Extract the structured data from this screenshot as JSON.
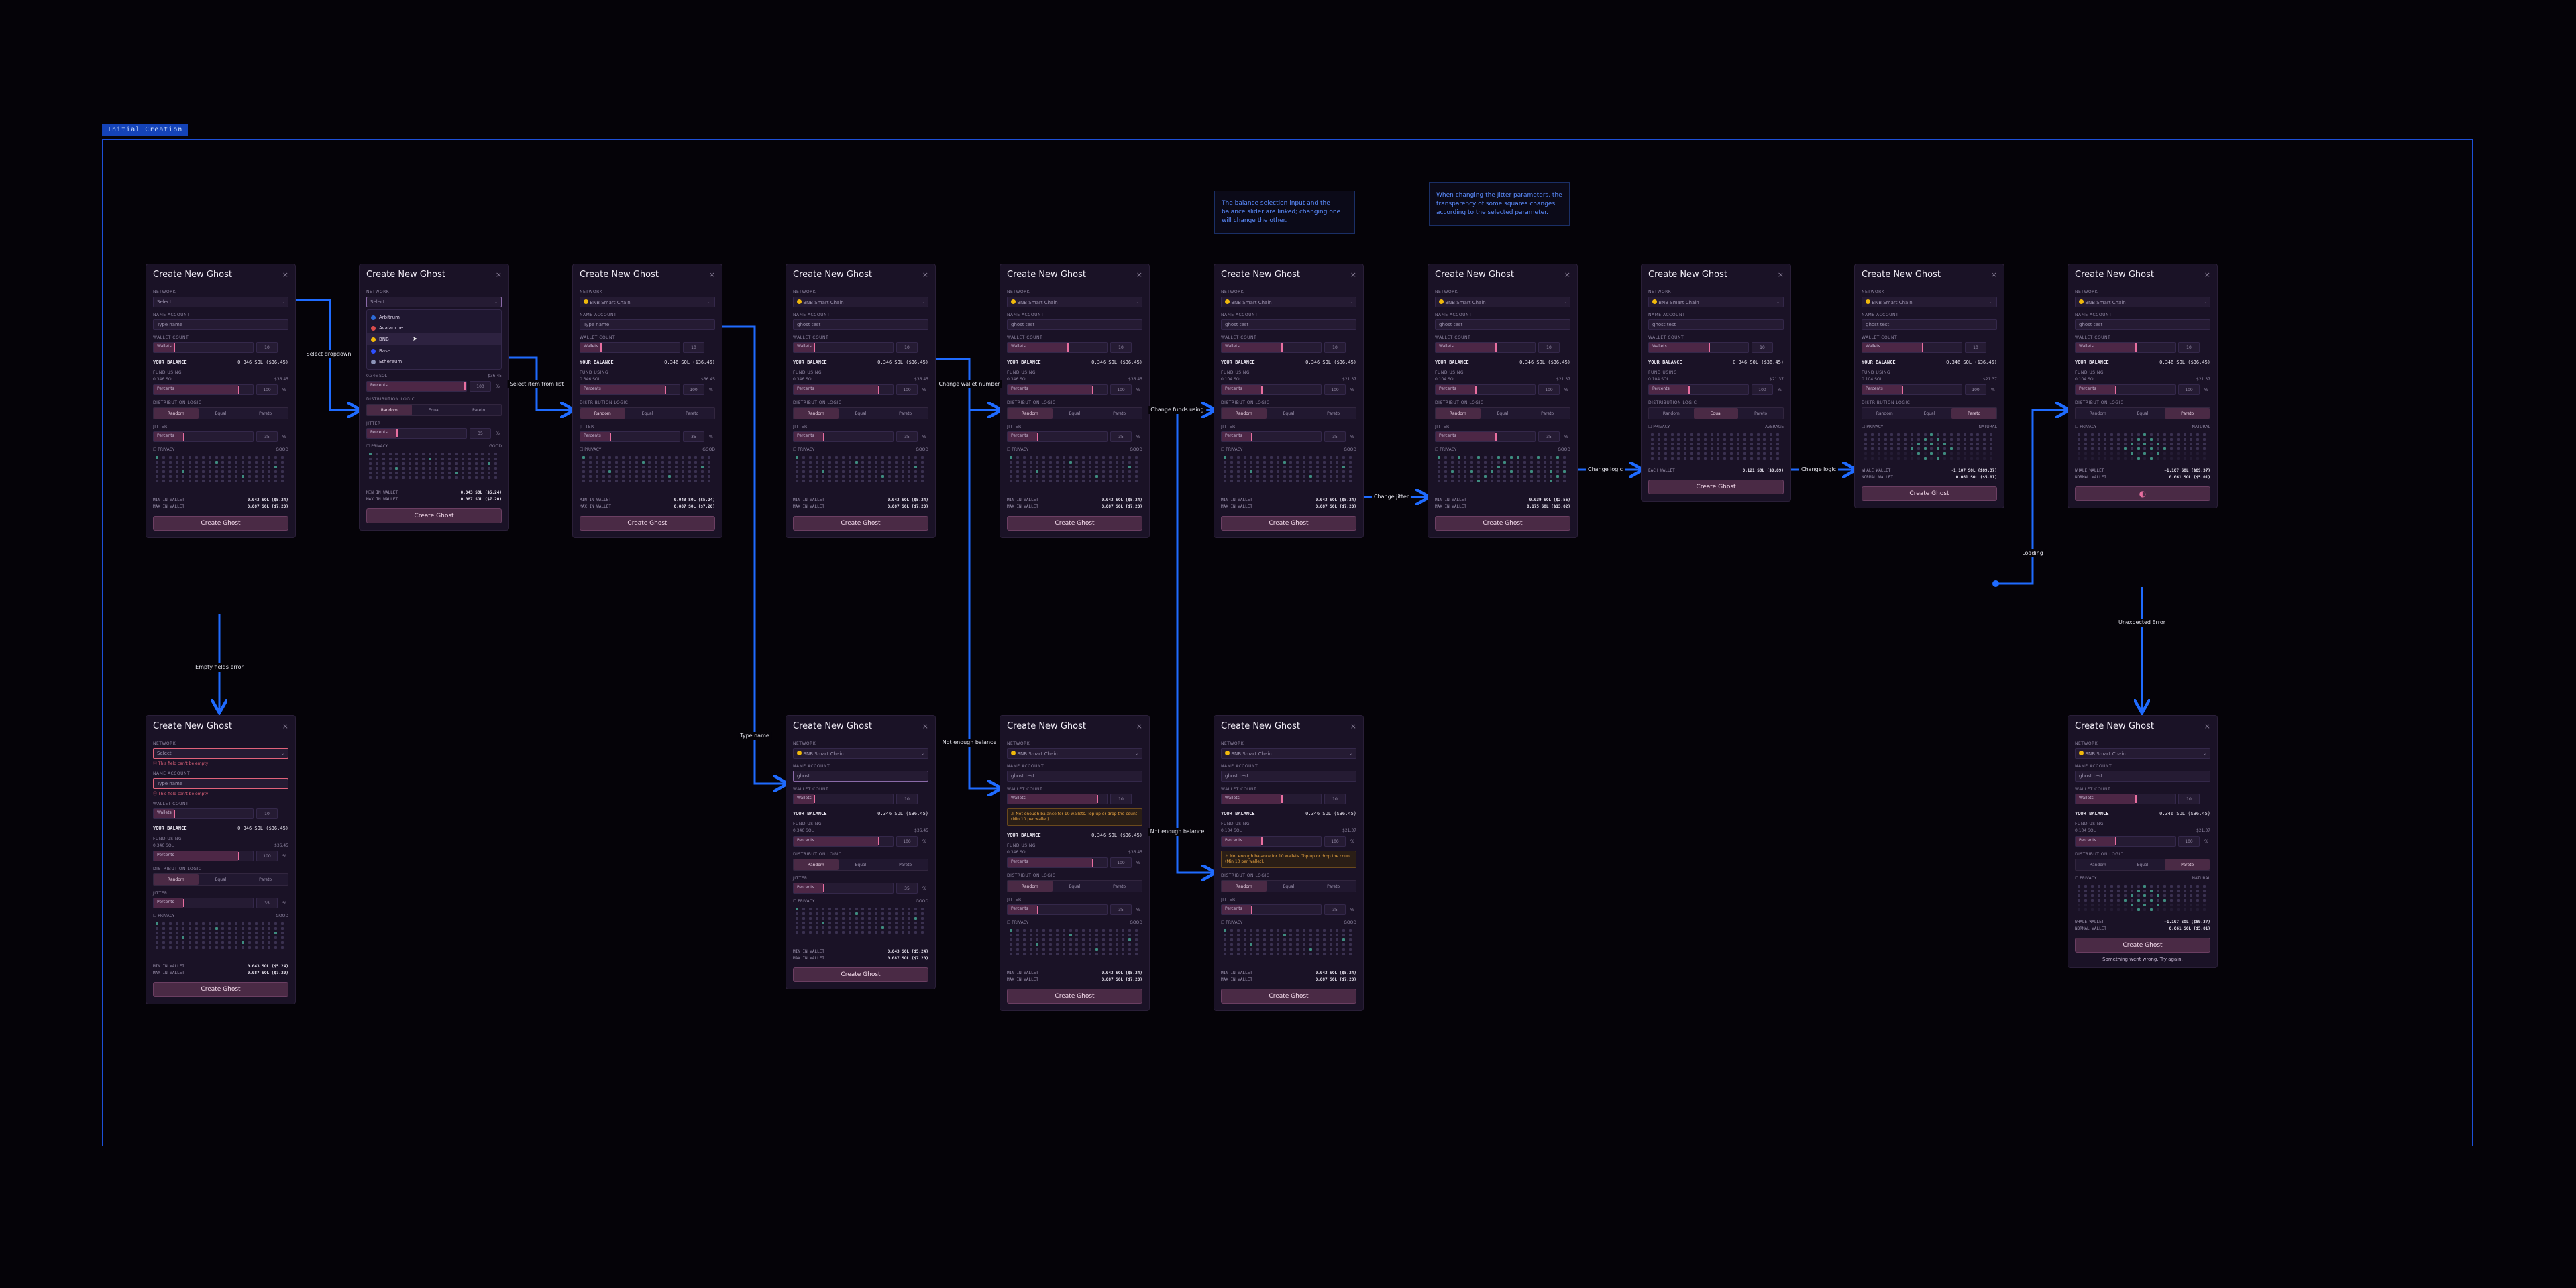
{
  "section": {
    "label": "Initial Creation"
  },
  "notes": [
    {
      "id": "note-balance",
      "text": "The balance selection input and the balance slider are linked; changing one will change the other."
    },
    {
      "id": "note-jitter",
      "text": "When changing the Jitter parameters, the transparency of some squares changes according to the selected parameter."
    }
  ],
  "edge_labels": {
    "select_dropdown": "Select dropdown",
    "select_item": "Select item from list",
    "change_wallet": "Change wallet number",
    "change_funds": "Change funds using",
    "change_jitter": "Change jitter",
    "change_logic_1": "Change logic",
    "change_logic_2": "Change logic",
    "loading": "Loading",
    "empty_fields": "Empty fields error",
    "type_name": "Type name",
    "not_enough_1": "Not enough balance",
    "not_enough_2": "Not enough balance",
    "unexpected": "Unexpected Error"
  },
  "ui": {
    "title": "Create New Ghost",
    "close": "×",
    "network_label": "NETWORK",
    "select_placeholder": "Select",
    "network_value": "BNB Smart Chain",
    "name_label": "NAME ACCOUNT",
    "name_placeholder": "Type name",
    "name_value": "ghost test",
    "name_typing": "ghost",
    "wallet_label": "WALLET COUNT",
    "wallet_slider_text": "Wallets",
    "wallet_num": "10",
    "balance_label": "YOUR BALANCE",
    "balance_value": "0.346 SOL ($36.45)",
    "funds_label": "FUND USING",
    "funds_value": "0.346 SOL",
    "funds_usd": "$36.45",
    "funds_value_alt": "0.104 SOL",
    "funds_usd_alt": "$21.37",
    "percent_text": "Percents",
    "percent_num": "100",
    "percent_unit": "%",
    "dist_label": "DISTRIBUTION LOGIC",
    "dist_options": [
      "Random",
      "Equal",
      "Pareto"
    ],
    "jitter_label": "JITTER",
    "jitter_num": "35",
    "privacy_label": "PRIVACY",
    "privacy_good": "GOOD",
    "privacy_average": "AVERAGE",
    "privacy_natural": "NATURAL",
    "min_label": "MIN IN WALLET",
    "max_label": "MAX IN WALLET",
    "min_value": "0.043 SOL ($5.24)",
    "max_value": "0.087 SOL ($7.20)",
    "min_value_jit": "0.039 SOL ($2.56)",
    "max_value_jit": "0.175 SOL ($13.02)",
    "each_label": "EACH WALLET",
    "each_value": "0.121 SOL ($9.89)",
    "whale_label": "WHALE WALLET",
    "whale_value": "~1.107 SOL ($89.37)",
    "normal_label": "NORMAL WALLET",
    "normal_value": "0.061 SOL ($5.01)",
    "cta": "Create Ghost",
    "loading_icon": "◐",
    "err_required": "This field can't be empty",
    "warn_balance": "Not enough balance for 10 wallets. Top up or drop the count (Min 10 per wallet).",
    "footer_error": "Something went wrong. Try again."
  },
  "networks": [
    "Arbitrum",
    "Avalanche",
    "BNB",
    "Base",
    "Ethereum"
  ],
  "colors": {
    "wire": "#1f6bff",
    "accent": "#e86fa0",
    "teal": "#3f8d80"
  }
}
